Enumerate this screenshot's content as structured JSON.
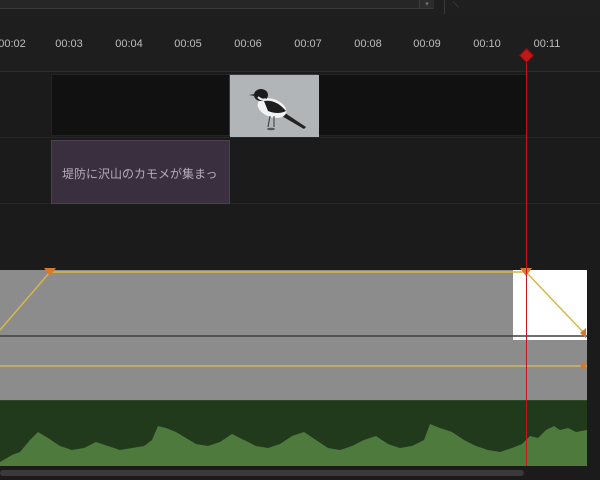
{
  "ruler": {
    "labels": [
      "00:02",
      "00:03",
      "00:04",
      "00:05",
      "00:06",
      "00:07",
      "00:08",
      "00:09",
      "00:10",
      "00:11"
    ]
  },
  "video_track": {
    "thumbnail_icon": "bird-wagtail-image"
  },
  "text_track": {
    "clip_text": "堤防に沢山のカモメが集まっ"
  },
  "colors": {
    "playhead": "#c01818",
    "keyframe": "#d9772a",
    "volume_line": "#d4b94a",
    "waveform": "#4f7a3e"
  },
  "scrollbar": {
    "thumb_fraction": 0.87
  }
}
